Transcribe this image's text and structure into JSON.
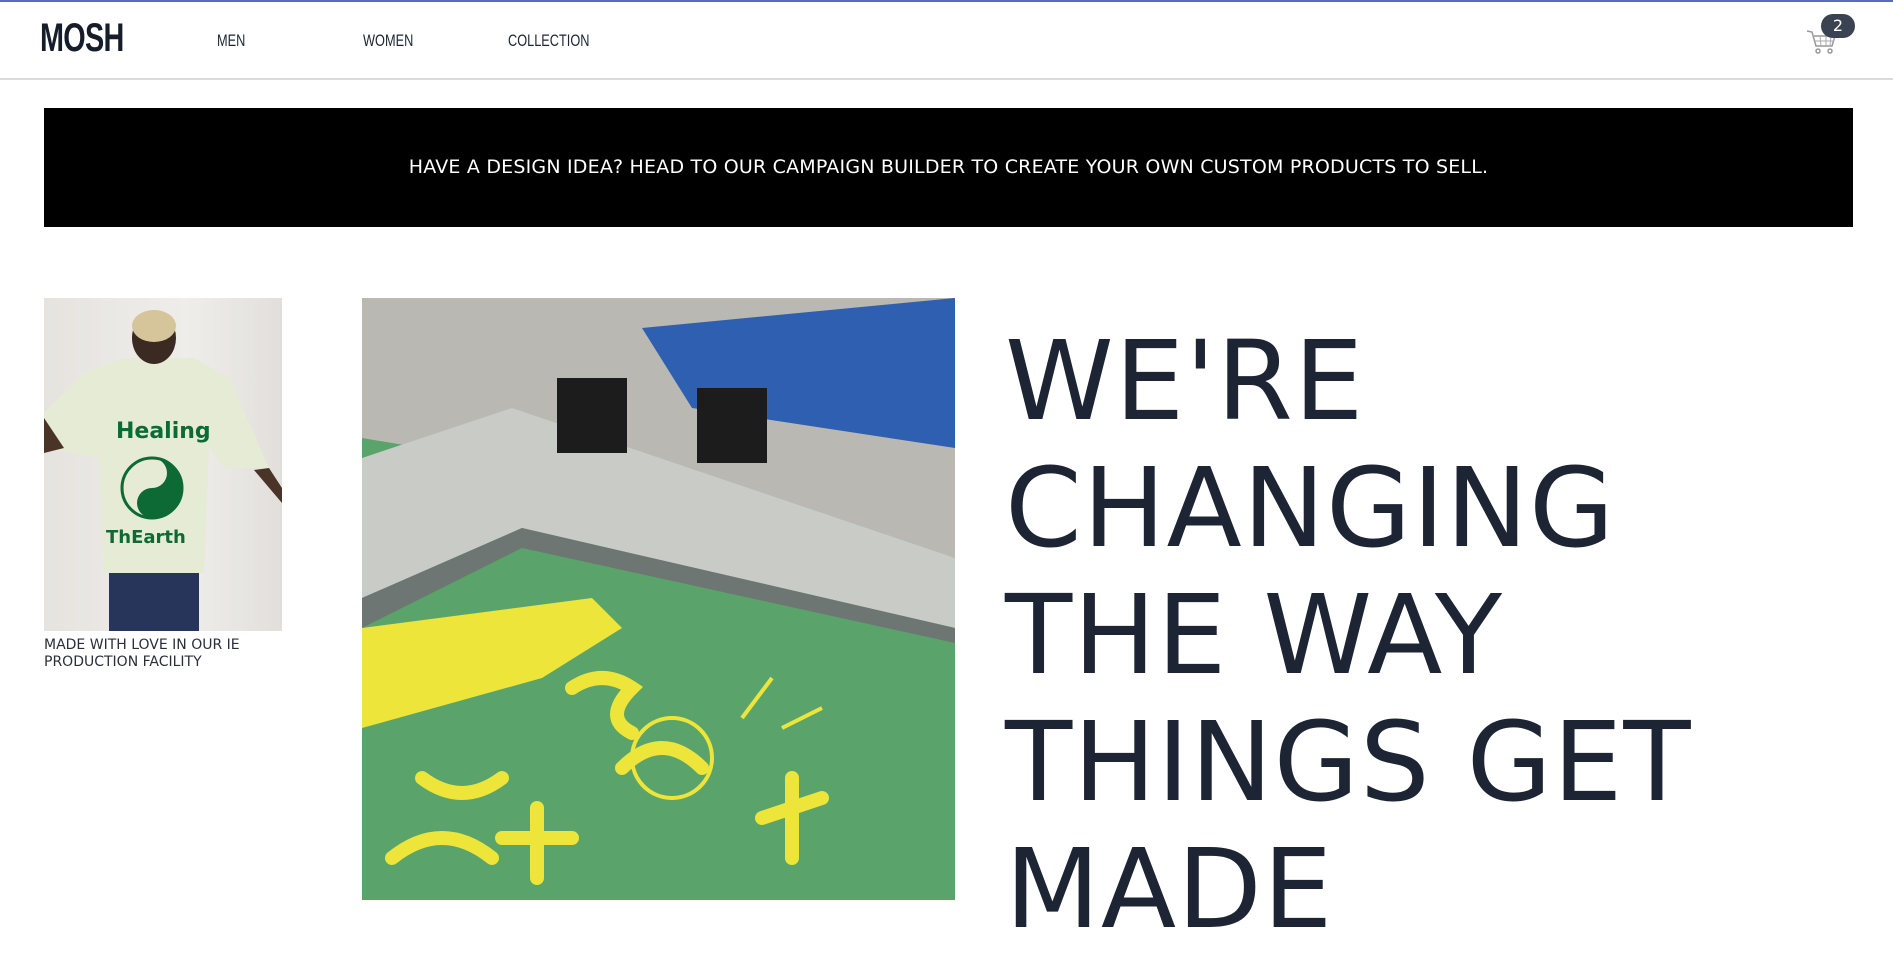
{
  "header": {
    "logo": "MOSH",
    "nav": [
      {
        "label": "MEN"
      },
      {
        "label": "WOMEN"
      },
      {
        "label": "COLLECTION"
      }
    ],
    "cart_count": "2"
  },
  "banner": {
    "text": "HAVE A DESIGN IDEA? HEAD TO OUR CAMPAIGN BUILDER TO CREATE YOUR OWN CUSTOM PRODUCTS TO SELL."
  },
  "feature": {
    "caption": "MADE WITH LOVE IN OUR IE PRODUCTION FACILITY",
    "heading_lines": [
      "WE'RE",
      "CHANGING",
      "THE WAY",
      "THINGS GET",
      "MADE"
    ]
  }
}
